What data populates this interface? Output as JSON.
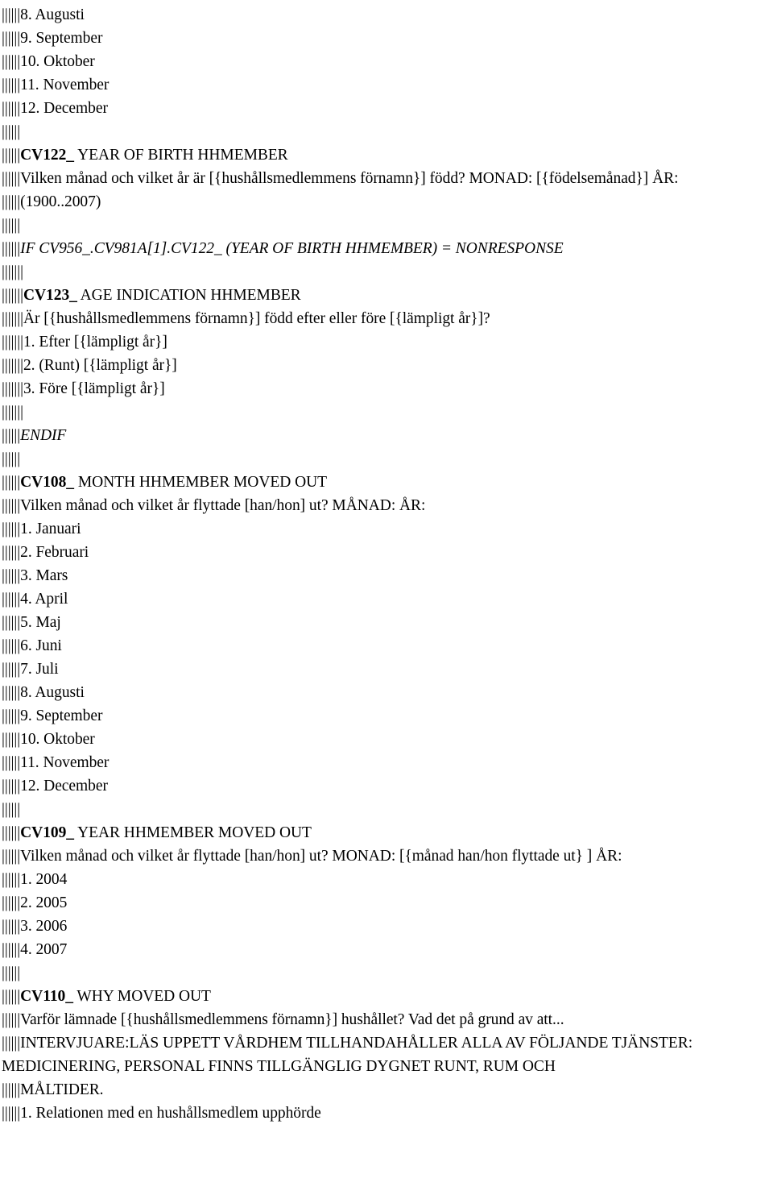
{
  "document": {
    "type": "survey-questionnaire-codebook",
    "language_note": "Swedish questionnaire text with English variable headings",
    "indent_char": "|",
    "lines": [
      {
        "id": "l01",
        "pipes": 6,
        "style": "plain",
        "text": "8. Augusti"
      },
      {
        "id": "l02",
        "pipes": 6,
        "style": "plain",
        "text": "9. September"
      },
      {
        "id": "l03",
        "pipes": 6,
        "style": "plain",
        "text": "10. Oktober"
      },
      {
        "id": "l04",
        "pipes": 6,
        "style": "plain",
        "text": "11. November"
      },
      {
        "id": "l05",
        "pipes": 6,
        "style": "plain",
        "text": "12. December"
      },
      {
        "id": "l06",
        "pipes": 6,
        "style": "blank",
        "text": ""
      },
      {
        "id": "l07",
        "pipes": 6,
        "style": "code",
        "code": "CV122_",
        "text": " YEAR OF BIRTH HHMEMBER"
      },
      {
        "id": "l08",
        "pipes": 6,
        "style": "plain",
        "text": "Vilken månad och vilket år är [{hushållsmedlemmens förnamn}] född? MONAD: [{födelsemånad}] ÅR:"
      },
      {
        "id": "l09",
        "pipes": 6,
        "style": "plain",
        "text": "(1900..2007)"
      },
      {
        "id": "l10",
        "pipes": 6,
        "style": "blank",
        "text": ""
      },
      {
        "id": "l11",
        "pipes": 6,
        "style": "italic",
        "text": "IF CV956_.CV981A[1].CV122_ (YEAR OF BIRTH HHMEMBER) = NONRESPONSE"
      },
      {
        "id": "l12",
        "pipes": 7,
        "style": "blank",
        "text": ""
      },
      {
        "id": "l13",
        "pipes": 7,
        "style": "code",
        "code": "CV123_",
        "text": " AGE INDICATION HHMEMBER"
      },
      {
        "id": "l14",
        "pipes": 7,
        "style": "plain",
        "text": "Är [{hushållsmedlemmens förnamn}] född efter eller före [{lämpligt år}]?"
      },
      {
        "id": "l15",
        "pipes": 7,
        "style": "plain",
        "text": "1. Efter [{lämpligt år}]"
      },
      {
        "id": "l16",
        "pipes": 7,
        "style": "plain",
        "text": "2. (Runt) [{lämpligt år}]"
      },
      {
        "id": "l17",
        "pipes": 7,
        "style": "plain",
        "text": "3. Före [{lämpligt år}]"
      },
      {
        "id": "l18",
        "pipes": 7,
        "style": "blank",
        "text": ""
      },
      {
        "id": "l19",
        "pipes": 6,
        "style": "italic",
        "text": "ENDIF"
      },
      {
        "id": "l20",
        "pipes": 6,
        "style": "blank",
        "text": ""
      },
      {
        "id": "l21",
        "pipes": 6,
        "style": "code",
        "code": "CV108_",
        "text": " MONTH HHMEMBER MOVED OUT"
      },
      {
        "id": "l22",
        "pipes": 6,
        "style": "plain",
        "text": "Vilken månad och vilket år flyttade [han/hon] ut? MÅNAD: ÅR:"
      },
      {
        "id": "l23",
        "pipes": 6,
        "style": "plain",
        "text": "1. Januari"
      },
      {
        "id": "l24",
        "pipes": 6,
        "style": "plain",
        "text": "2. Februari"
      },
      {
        "id": "l25",
        "pipes": 6,
        "style": "plain",
        "text": "3. Mars"
      },
      {
        "id": "l26",
        "pipes": 6,
        "style": "plain",
        "text": "4. April"
      },
      {
        "id": "l27",
        "pipes": 6,
        "style": "plain",
        "text": "5. Maj"
      },
      {
        "id": "l28",
        "pipes": 6,
        "style": "plain",
        "text": "6. Juni"
      },
      {
        "id": "l29",
        "pipes": 6,
        "style": "plain",
        "text": "7. Juli"
      },
      {
        "id": "l30",
        "pipes": 6,
        "style": "plain",
        "text": "8. Augusti"
      },
      {
        "id": "l31",
        "pipes": 6,
        "style": "plain",
        "text": "9. September"
      },
      {
        "id": "l32",
        "pipes": 6,
        "style": "plain",
        "text": "10. Oktober"
      },
      {
        "id": "l33",
        "pipes": 6,
        "style": "plain",
        "text": "11. November"
      },
      {
        "id": "l34",
        "pipes": 6,
        "style": "plain",
        "text": "12. December"
      },
      {
        "id": "l35",
        "pipes": 6,
        "style": "blank",
        "text": ""
      },
      {
        "id": "l36",
        "pipes": 6,
        "style": "code",
        "code": "CV109_",
        "text": " YEAR HHMEMBER MOVED OUT"
      },
      {
        "id": "l37",
        "pipes": 6,
        "style": "plain",
        "text": "Vilken månad och vilket år flyttade [han/hon] ut? MONAD: [{månad han/hon flyttade ut} ] ÅR:"
      },
      {
        "id": "l38",
        "pipes": 6,
        "style": "plain",
        "text": "1. 2004"
      },
      {
        "id": "l39",
        "pipes": 6,
        "style": "plain",
        "text": "2. 2005"
      },
      {
        "id": "l40",
        "pipes": 6,
        "style": "plain",
        "text": "3. 2006"
      },
      {
        "id": "l41",
        "pipes": 6,
        "style": "plain",
        "text": "4. 2007"
      },
      {
        "id": "l42",
        "pipes": 6,
        "style": "blank",
        "text": ""
      },
      {
        "id": "l43",
        "pipes": 6,
        "style": "code",
        "code": "CV110_",
        "text": " WHY MOVED OUT"
      },
      {
        "id": "l44",
        "pipes": 6,
        "style": "plain",
        "text": "Varför lämnade [{hushållsmedlemmens förnamn}] hushållet? Vad det på grund av att..."
      },
      {
        "id": "l45",
        "pipes": 6,
        "style": "plain",
        "text": "INTERVJUARE:LÄS UPPETT VÅRDHEM TILLHANDAHÅLLER ALLA AV FÖLJANDE TJÄNSTER: MEDICINERING, PERSONAL FINNS TILLGÄNGLIG DYGNET RUNT, RUM OCH"
      },
      {
        "id": "l46",
        "pipes": 6,
        "style": "plain",
        "text": "MÅLTIDER."
      },
      {
        "id": "l47",
        "pipes": 6,
        "style": "plain",
        "text": "1. Relationen med en hushållsmedlem upphörde"
      }
    ]
  }
}
